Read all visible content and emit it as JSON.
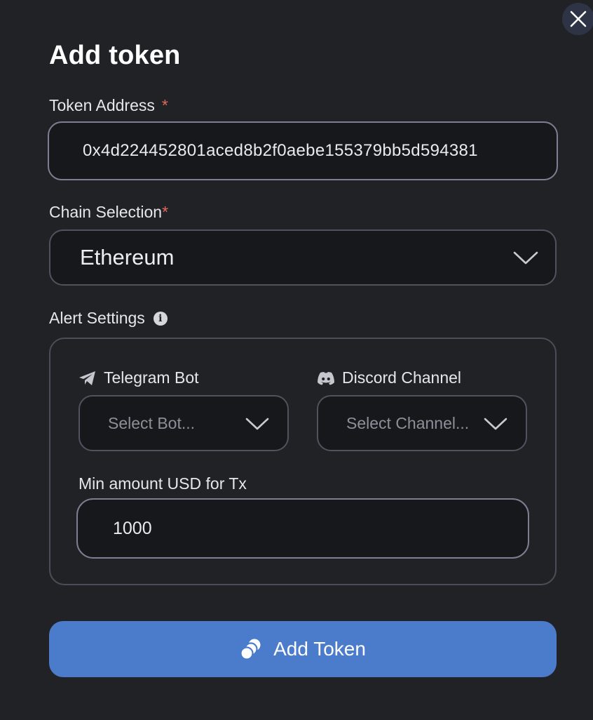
{
  "modal": {
    "title": "Add token",
    "close_icon": "close-icon"
  },
  "token_address": {
    "label": "Token Address",
    "required_mark": "*",
    "value": "0x4d224452801aced8b2f0aebe155379bb5d594381"
  },
  "chain_selection": {
    "label": "Chain Selection",
    "required_mark": "*",
    "selected": "Ethereum"
  },
  "alert_settings": {
    "label": "Alert Settings",
    "info_icon": "info-icon",
    "telegram": {
      "label": "Telegram Bot",
      "icon": "telegram-icon",
      "placeholder": "Select Bot..."
    },
    "discord": {
      "label": "Discord Channel",
      "icon": "discord-icon",
      "placeholder": "Select Channel..."
    },
    "min_amount": {
      "label": "Min amount USD for Tx",
      "value": "1000"
    }
  },
  "submit": {
    "label": "Add Token",
    "icon": "coins-icon"
  },
  "colors": {
    "background": "#212226",
    "accent": "#4b7ccb",
    "required": "#e5685e"
  }
}
